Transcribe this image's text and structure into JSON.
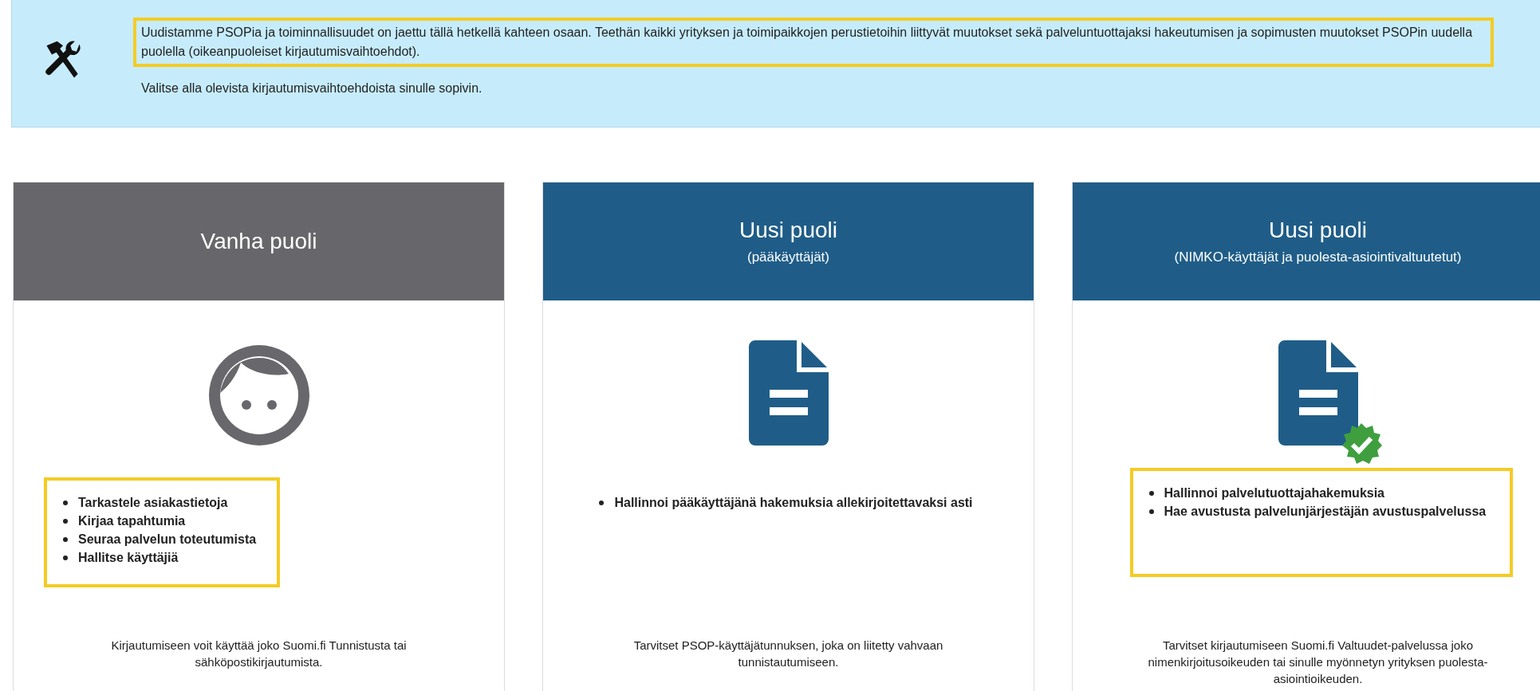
{
  "notice": {
    "paragraphs": [
      {
        "text": "Uudistamme PSOPia ja toiminnallisuudet on jaettu tällä hetkellä kahteen osaan. Teethän kaikki yrityksen ja toimipaikkojen perustietoihin liittyvät muutokset sekä palveluntuottajaksi hakeutumisen ja sopimusten muutokset PSOPin uudella puolella (oikeanpuoleiset kirjautumisvaihtoehdot).",
        "highlighted": true
      },
      {
        "text": "Valitse alla olevista kirjautumisvaihtoehdoista sinulle sopivin.",
        "highlighted": false
      }
    ]
  },
  "cards": [
    {
      "title": "Vanha puoli",
      "kind": "legacy",
      "verified": false,
      "features_highlighted": true,
      "features": [
        "Tarkastele asiakastietoja",
        "Kirjaa tapahtumia",
        "Seuraa palvelun toteutumista",
        "Hallitse käyttäjiä"
      ],
      "description": "Kirjautumiseen voit käyttää joko Suomi.fi Tunnistusta tai sähköpostikirjautumista."
    },
    {
      "title": "Uusi puoli",
      "subtitle": "(pääkäyttäjät)",
      "kind": "new",
      "verified": false,
      "features_highlighted": false,
      "features": [
        "Hallinnoi pääkäyttäjänä hakemuksia allekirjoitettavaksi asti"
      ],
      "description": "Tarvitset PSOP-käyttäjätunnuksen, joka on liitetty vahvaan tunnistautumiseen."
    },
    {
      "title": "Uusi puoli",
      "subtitle": "(NIMKO-käyttäjät ja puolesta-asiointivaltuutetut)",
      "kind": "new",
      "verified": true,
      "features_highlighted": true,
      "features": [
        "Hallinnoi palvelutuottajahakemuksia",
        "Hae avustusta palvelunjärjestäjän avustuspalvelussa"
      ],
      "description": "Tarvitset kirjautumiseen Suomi.fi Valtuudet-palvelussa joko nimenkirjoitusoikeuden tai sinulle myönnetyn yrityksen puolesta-asiointioikeuden."
    }
  ]
}
